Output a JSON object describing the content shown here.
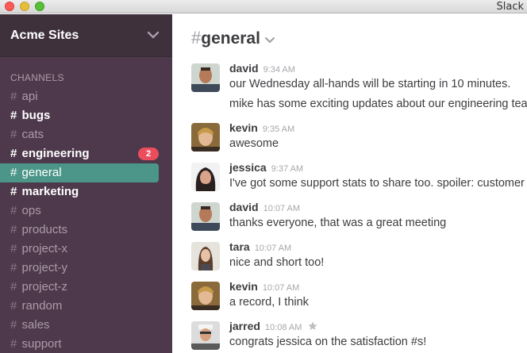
{
  "window": {
    "app_title": "Slack"
  },
  "team": {
    "name": "Acme Sites"
  },
  "sidebar": {
    "channels_heading": "CHANNELS",
    "channels": [
      {
        "name": "api",
        "state": "normal"
      },
      {
        "name": "bugs",
        "state": "unread"
      },
      {
        "name": "cats",
        "state": "normal"
      },
      {
        "name": "engineering",
        "state": "unread",
        "badge": "2"
      },
      {
        "name": "general",
        "state": "active"
      },
      {
        "name": "marketing",
        "state": "unread"
      },
      {
        "name": "ops",
        "state": "normal"
      },
      {
        "name": "products",
        "state": "normal"
      },
      {
        "name": "project-x",
        "state": "normal"
      },
      {
        "name": "project-y",
        "state": "normal"
      },
      {
        "name": "project-z",
        "state": "normal"
      },
      {
        "name": "random",
        "state": "normal"
      },
      {
        "name": "sales",
        "state": "normal"
      },
      {
        "name": "support",
        "state": "normal"
      }
    ]
  },
  "header": {
    "hash": "#",
    "channel_name": "general"
  },
  "messages": [
    {
      "author": "david",
      "time": "9:34 AM",
      "lines": [
        "our Wednesday all-hands will be starting in 10 minutes.",
        "mike has some exciting updates about our engineering tea"
      ]
    },
    {
      "author": "kevin",
      "time": "9:35 AM",
      "lines": [
        "awesome"
      ]
    },
    {
      "author": "jessica",
      "time": "9:37 AM",
      "lines": [
        "I've got some support stats to share too. spoiler: customer"
      ]
    },
    {
      "author": "david",
      "time": "10:07 AM",
      "lines": [
        "thanks everyone, that was a great meeting"
      ]
    },
    {
      "author": "tara",
      "time": "10:07 AM",
      "lines": [
        "nice and short too!"
      ]
    },
    {
      "author": "kevin",
      "time": "10:07 AM",
      "lines": [
        "a record, I think"
      ]
    },
    {
      "author": "jarred",
      "time": "10:08 AM",
      "lines": [
        "congrats jessica on the satisfaction #s!"
      ],
      "starrable": true
    }
  ],
  "colors": {
    "sidebar_bg": "#4d394b",
    "team_header_bg": "#3e313c",
    "active_channel_bg": "#4c9689",
    "badge_bg": "#eb4d5c"
  }
}
